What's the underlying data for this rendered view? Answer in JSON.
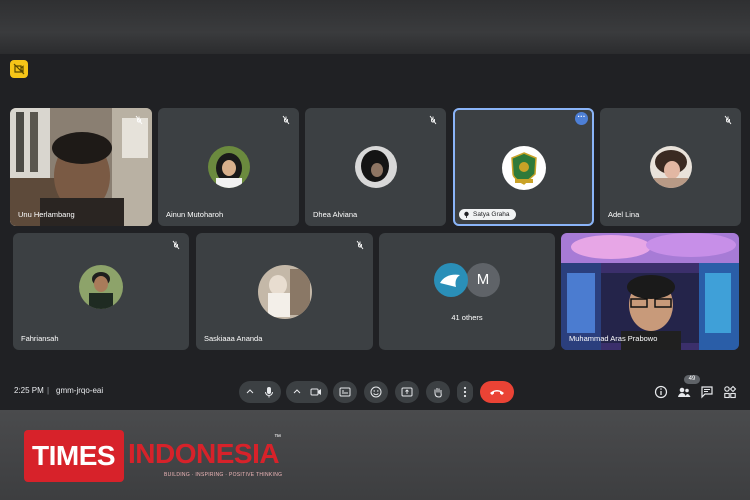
{
  "participants": [
    {
      "name": "Unu Herlambang"
    },
    {
      "name": "Ainun Mutoharoh"
    },
    {
      "name": "Dhea Alviana"
    },
    {
      "name": "Satya Graha"
    },
    {
      "name": "Adel Lina"
    },
    {
      "name": "Fahriansah"
    },
    {
      "name": "Saskiaaa Ananda"
    },
    {
      "name": "Muhammad Aras Prabowo"
    }
  ],
  "others": {
    "count_label": "41 others",
    "avatar_letter": "M"
  },
  "controls": {
    "time": "2:25 PM",
    "separator": "|",
    "meeting_code": "gmm-jrqo-eai",
    "people_count": "49"
  },
  "brand": {
    "times": "TIMES",
    "indonesia": "INDONESIA",
    "tagline": "BUILDING · INSPIRING · POSITIVE THINKING",
    "tm": "™"
  },
  "colors": {
    "background": "#202124",
    "tile": "#3c4043",
    "active_outline": "#8ab4f8",
    "end_call": "#ea4335",
    "brand_red": "#d7222a"
  }
}
